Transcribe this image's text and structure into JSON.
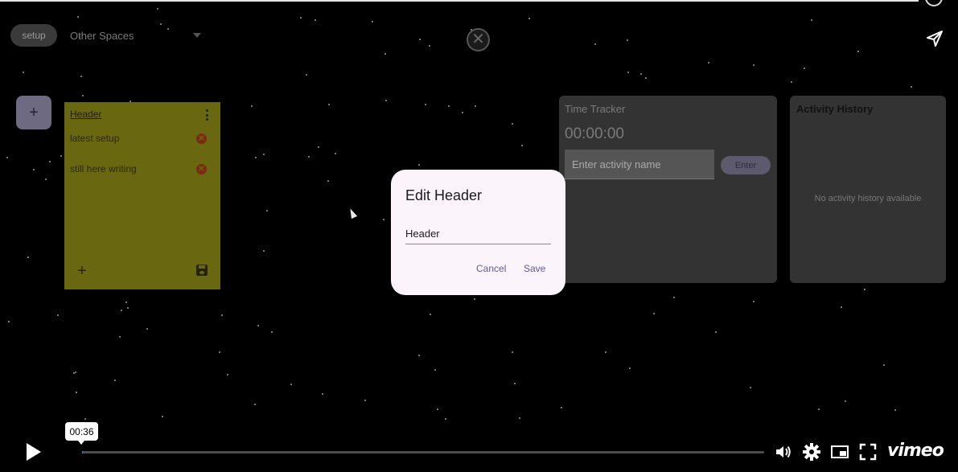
{
  "workspace": {
    "current_space": "setup",
    "space_selector": "Other Spaces"
  },
  "note": {
    "header": "Header",
    "items": [
      {
        "text": "latest setup"
      },
      {
        "text": "still here writing"
      }
    ]
  },
  "tracker": {
    "title": "Time Tracker",
    "time": "00:00:00",
    "input_placeholder": "Enter activity name",
    "enter_label": "Enter"
  },
  "history": {
    "title": "Activity History",
    "empty_text": "No activity history available"
  },
  "dialog": {
    "title": "Edit Header",
    "input_value": "Header",
    "cancel_label": "Cancel",
    "save_label": "Save"
  },
  "player": {
    "time_tooltip": "00:36",
    "progress_fraction": 0.001,
    "brand": "vimeo",
    "accent_color": "#00adef"
  },
  "icons": {
    "add_card": "+",
    "close": "✕",
    "note_remove": "✕",
    "note_add": "+"
  }
}
